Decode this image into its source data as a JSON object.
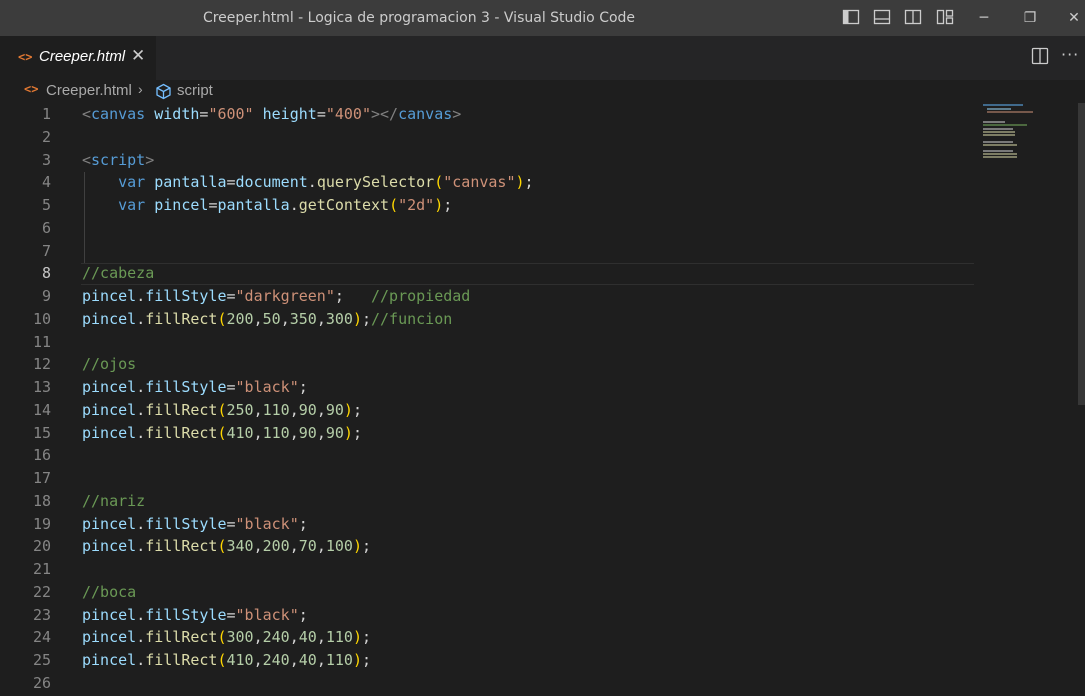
{
  "window": {
    "title": "Creeper.html - Logica de programacion 3 - Visual Studio Code",
    "layout_icons": [
      "toggle-primary-sidebar-icon",
      "toggle-panel-icon",
      "toggle-secondary-sidebar-icon",
      "customize-layout-icon"
    ],
    "controls": {
      "minimize": "─",
      "restore": "❐",
      "close": "✕"
    }
  },
  "tab": {
    "icon": "<>",
    "label": "Creeper.html",
    "close": "✕"
  },
  "editor_actions": {
    "split_icon": "split-editor-icon",
    "more": "···"
  },
  "breadcrumb": {
    "file_icon": "<>",
    "file": "Creeper.html",
    "separator": "›",
    "symbol_icon": "symbol-namespace-icon",
    "symbol": "script"
  },
  "active_line": 8,
  "colors": {
    "tag": "#808080",
    "tag_name": "#569cd6",
    "attr": "#9cdcfe",
    "string": "#ce9178",
    "keyword": "#569cd6",
    "variable": "#9cdcfe",
    "function": "#dcdcaa",
    "comment": "#6a9955",
    "number": "#b5cea8",
    "bracket1": "#ffd700",
    "bracket2": "#da70d6",
    "plain": "#d4d4d4"
  },
  "code_lines": [
    {
      "n": "1",
      "tokens": [
        [
          "<",
          "tag"
        ],
        [
          "canvas",
          "tag_name"
        ],
        [
          " ",
          "plain"
        ],
        [
          "width",
          "attr"
        ],
        [
          "=",
          "plain"
        ],
        [
          "\"600\"",
          "string"
        ],
        [
          " ",
          "plain"
        ],
        [
          "height",
          "attr"
        ],
        [
          "=",
          "plain"
        ],
        [
          "\"400\"",
          "string"
        ],
        [
          "></",
          "tag"
        ],
        [
          "canvas",
          "tag_name"
        ],
        [
          ">",
          "tag"
        ]
      ]
    },
    {
      "n": "2",
      "tokens": []
    },
    {
      "n": "3",
      "tokens": [
        [
          "<",
          "tag"
        ],
        [
          "script",
          "tag_name"
        ],
        [
          ">",
          "tag"
        ]
      ]
    },
    {
      "n": "4",
      "tokens": [
        [
          "    ",
          "plain"
        ],
        [
          "var",
          "keyword"
        ],
        [
          " ",
          "plain"
        ],
        [
          "pantalla",
          "variable"
        ],
        [
          "=",
          "plain"
        ],
        [
          "document",
          "variable"
        ],
        [
          ".",
          "plain"
        ],
        [
          "querySelector",
          "function"
        ],
        [
          "(",
          "bracket1"
        ],
        [
          "\"canvas\"",
          "string"
        ],
        [
          ")",
          "bracket1"
        ],
        [
          ";",
          "plain"
        ]
      ]
    },
    {
      "n": "5",
      "tokens": [
        [
          "    ",
          "plain"
        ],
        [
          "var",
          "keyword"
        ],
        [
          " ",
          "plain"
        ],
        [
          "pincel",
          "variable"
        ],
        [
          "=",
          "plain"
        ],
        [
          "pantalla",
          "variable"
        ],
        [
          ".",
          "plain"
        ],
        [
          "getContext",
          "function"
        ],
        [
          "(",
          "bracket1"
        ],
        [
          "\"2d\"",
          "string"
        ],
        [
          ")",
          "bracket1"
        ],
        [
          ";",
          "plain"
        ]
      ]
    },
    {
      "n": "6",
      "tokens": []
    },
    {
      "n": "7",
      "tokens": []
    },
    {
      "n": "8",
      "tokens": [
        [
          "//cabeza",
          "comment"
        ]
      ]
    },
    {
      "n": "9",
      "tokens": [
        [
          "pincel",
          "variable"
        ],
        [
          ".",
          "plain"
        ],
        [
          "fillStyle",
          "variable"
        ],
        [
          "=",
          "plain"
        ],
        [
          "\"darkgreen\"",
          "string"
        ],
        [
          ";   ",
          "plain"
        ],
        [
          "//propiedad",
          "comment"
        ]
      ]
    },
    {
      "n": "10",
      "tokens": [
        [
          "pincel",
          "variable"
        ],
        [
          ".",
          "plain"
        ],
        [
          "fillRect",
          "function"
        ],
        [
          "(",
          "bracket1"
        ],
        [
          "200",
          "number"
        ],
        [
          ",",
          "plain"
        ],
        [
          "50",
          "number"
        ],
        [
          ",",
          "plain"
        ],
        [
          "350",
          "number"
        ],
        [
          ",",
          "plain"
        ],
        [
          "300",
          "number"
        ],
        [
          ")",
          "bracket1"
        ],
        [
          ";",
          "plain"
        ],
        [
          "//funcion",
          "comment"
        ]
      ]
    },
    {
      "n": "11",
      "tokens": []
    },
    {
      "n": "12",
      "tokens": [
        [
          "//ojos",
          "comment"
        ]
      ]
    },
    {
      "n": "13",
      "tokens": [
        [
          "pincel",
          "variable"
        ],
        [
          ".",
          "plain"
        ],
        [
          "fillStyle",
          "variable"
        ],
        [
          "=",
          "plain"
        ],
        [
          "\"black\"",
          "string"
        ],
        [
          ";",
          "plain"
        ]
      ]
    },
    {
      "n": "14",
      "tokens": [
        [
          "pincel",
          "variable"
        ],
        [
          ".",
          "plain"
        ],
        [
          "fillRect",
          "function"
        ],
        [
          "(",
          "bracket1"
        ],
        [
          "250",
          "number"
        ],
        [
          ",",
          "plain"
        ],
        [
          "110",
          "number"
        ],
        [
          ",",
          "plain"
        ],
        [
          "90",
          "number"
        ],
        [
          ",",
          "plain"
        ],
        [
          "90",
          "number"
        ],
        [
          ")",
          "bracket1"
        ],
        [
          ";",
          "plain"
        ]
      ]
    },
    {
      "n": "15",
      "tokens": [
        [
          "pincel",
          "variable"
        ],
        [
          ".",
          "plain"
        ],
        [
          "fillRect",
          "function"
        ],
        [
          "(",
          "bracket1"
        ],
        [
          "410",
          "number"
        ],
        [
          ",",
          "plain"
        ],
        [
          "110",
          "number"
        ],
        [
          ",",
          "plain"
        ],
        [
          "90",
          "number"
        ],
        [
          ",",
          "plain"
        ],
        [
          "90",
          "number"
        ],
        [
          ")",
          "bracket1"
        ],
        [
          ";",
          "plain"
        ]
      ]
    },
    {
      "n": "16",
      "tokens": []
    },
    {
      "n": "17",
      "tokens": []
    },
    {
      "n": "18",
      "tokens": [
        [
          "//nariz",
          "comment"
        ]
      ]
    },
    {
      "n": "19",
      "tokens": [
        [
          "pincel",
          "variable"
        ],
        [
          ".",
          "plain"
        ],
        [
          "fillStyle",
          "variable"
        ],
        [
          "=",
          "plain"
        ],
        [
          "\"black\"",
          "string"
        ],
        [
          ";",
          "plain"
        ]
      ]
    },
    {
      "n": "20",
      "tokens": [
        [
          "pincel",
          "variable"
        ],
        [
          ".",
          "plain"
        ],
        [
          "fillRect",
          "function"
        ],
        [
          "(",
          "bracket1"
        ],
        [
          "340",
          "number"
        ],
        [
          ",",
          "plain"
        ],
        [
          "200",
          "number"
        ],
        [
          ",",
          "plain"
        ],
        [
          "70",
          "number"
        ],
        [
          ",",
          "plain"
        ],
        [
          "100",
          "number"
        ],
        [
          ")",
          "bracket1"
        ],
        [
          ";",
          "plain"
        ]
      ]
    },
    {
      "n": "21",
      "tokens": []
    },
    {
      "n": "22",
      "tokens": [
        [
          "//boca",
          "comment"
        ]
      ]
    },
    {
      "n": "23",
      "tokens": [
        [
          "pincel",
          "variable"
        ],
        [
          ".",
          "plain"
        ],
        [
          "fillStyle",
          "variable"
        ],
        [
          "=",
          "plain"
        ],
        [
          "\"black\"",
          "string"
        ],
        [
          ";",
          "plain"
        ]
      ]
    },
    {
      "n": "24",
      "tokens": [
        [
          "pincel",
          "variable"
        ],
        [
          ".",
          "plain"
        ],
        [
          "fillRect",
          "function"
        ],
        [
          "(",
          "bracket1"
        ],
        [
          "300",
          "number"
        ],
        [
          ",",
          "plain"
        ],
        [
          "240",
          "number"
        ],
        [
          ",",
          "plain"
        ],
        [
          "40",
          "number"
        ],
        [
          ",",
          "plain"
        ],
        [
          "110",
          "number"
        ],
        [
          ")",
          "bracket1"
        ],
        [
          ";",
          "plain"
        ]
      ]
    },
    {
      "n": "25",
      "tokens": [
        [
          "pincel",
          "variable"
        ],
        [
          ".",
          "plain"
        ],
        [
          "fillRect",
          "function"
        ],
        [
          "(",
          "bracket1"
        ],
        [
          "410",
          "number"
        ],
        [
          ",",
          "plain"
        ],
        [
          "240",
          "number"
        ],
        [
          ",",
          "plain"
        ],
        [
          "40",
          "number"
        ],
        [
          ",",
          "plain"
        ],
        [
          "110",
          "number"
        ],
        [
          ")",
          "bracket1"
        ],
        [
          ";",
          "plain"
        ]
      ]
    },
    {
      "n": "26",
      "tokens": []
    }
  ]
}
